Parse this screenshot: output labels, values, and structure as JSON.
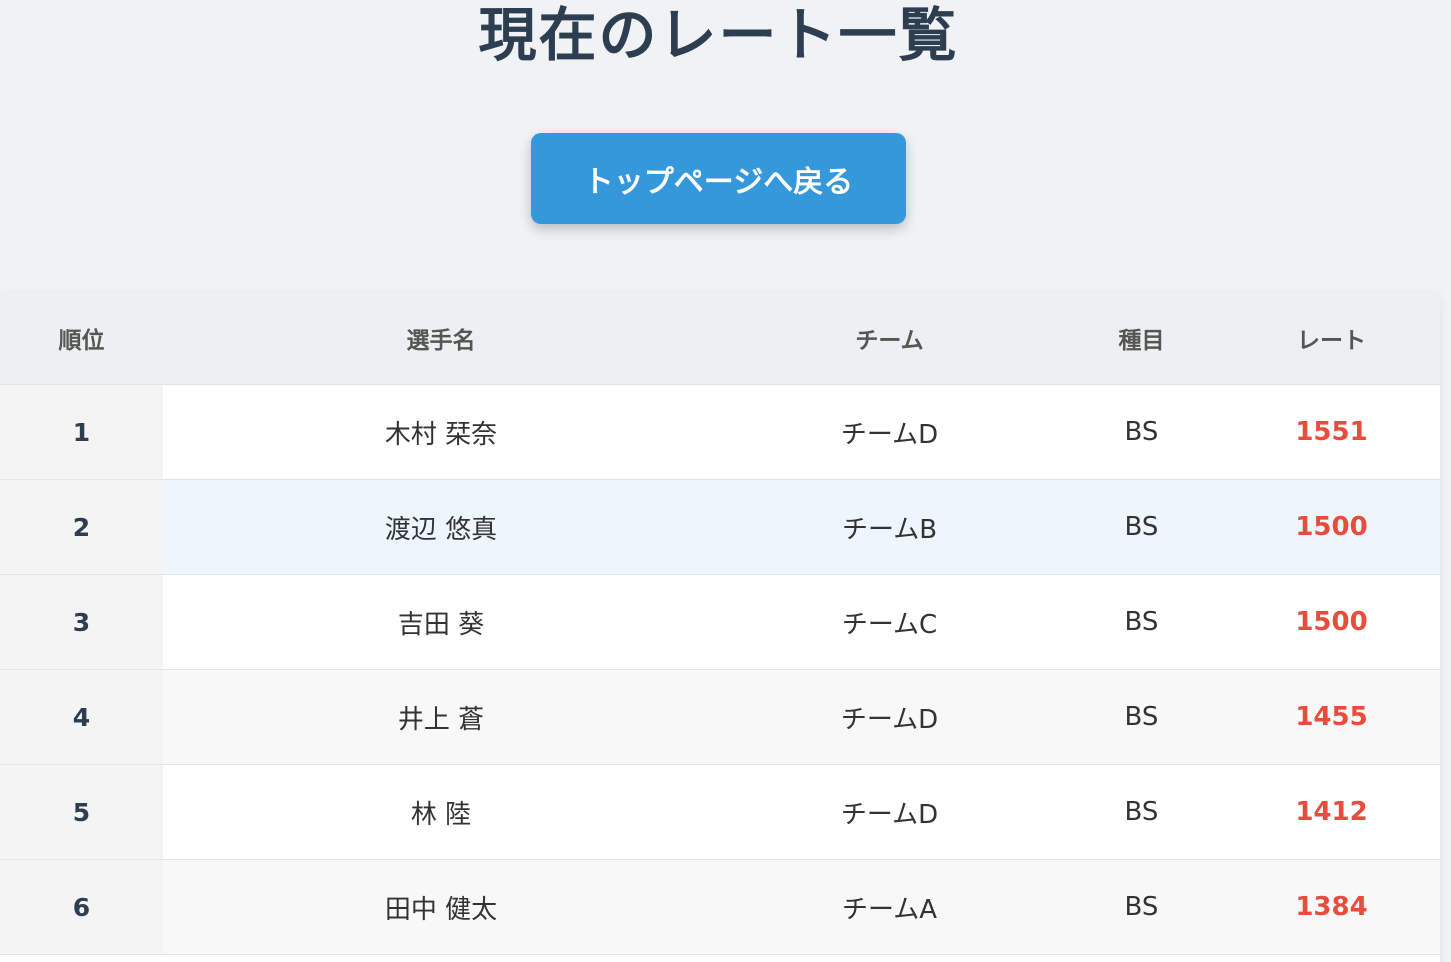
{
  "page": {
    "title": "現在のレート一覧",
    "back_button_label": "トップページへ戻る"
  },
  "table": {
    "headers": {
      "rank": "順位",
      "name": "選手名",
      "team": "チーム",
      "event": "種目",
      "rate": "レート"
    },
    "rows": [
      {
        "rank": "1",
        "name": "木村 栞奈",
        "team": "チームD",
        "event": "BS",
        "rate": "1551"
      },
      {
        "rank": "2",
        "name": "渡辺 悠真",
        "team": "チームB",
        "event": "BS",
        "rate": "1500"
      },
      {
        "rank": "3",
        "name": "吉田 葵",
        "team": "チームC",
        "event": "BS",
        "rate": "1500"
      },
      {
        "rank": "4",
        "name": "井上 蒼",
        "team": "チームD",
        "event": "BS",
        "rate": "1455"
      },
      {
        "rank": "5",
        "name": "林 陸",
        "team": "チームD",
        "event": "BS",
        "rate": "1412"
      },
      {
        "rank": "6",
        "name": "田中 健太",
        "team": "チームA",
        "event": "BS",
        "rate": "1384"
      }
    ]
  },
  "colors": {
    "title": "#2c3e50",
    "button": "#3498db",
    "rate": "#e74c3c",
    "header_bg": "#ecf0f1",
    "background": "#f0f2f5"
  }
}
